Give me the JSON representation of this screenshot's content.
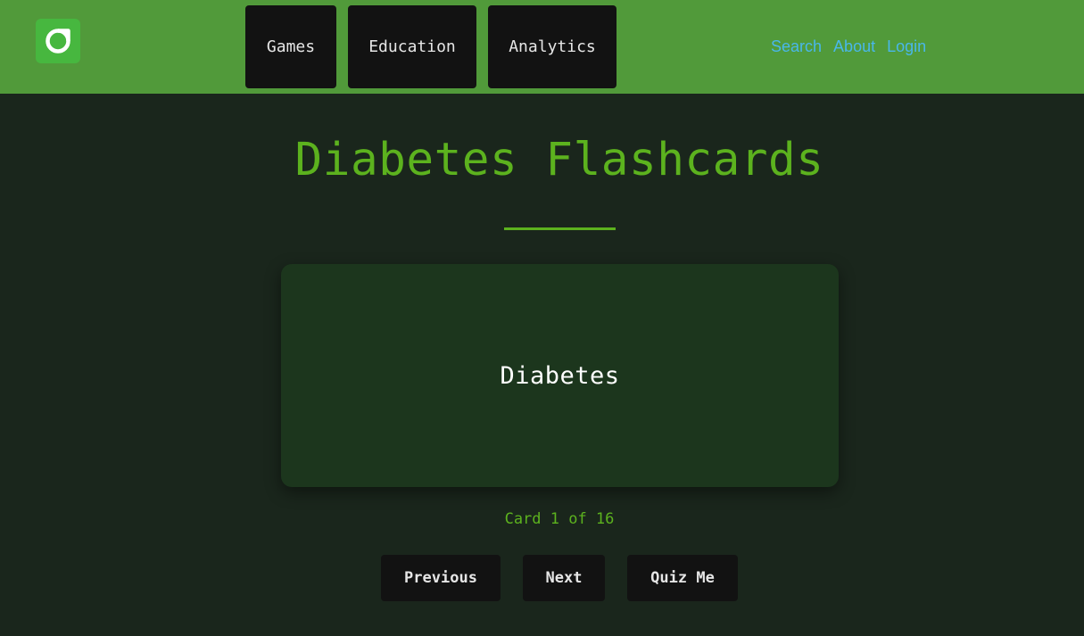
{
  "header": {
    "logo_icon": "app-logo-icon",
    "nav": [
      {
        "label": "Games"
      },
      {
        "label": "Education"
      },
      {
        "label": "Analytics"
      }
    ],
    "links": [
      {
        "label": "Search"
      },
      {
        "label": "About"
      },
      {
        "label": "Login"
      }
    ]
  },
  "main": {
    "title": "Diabetes Flashcards",
    "card": {
      "text": "Diabetes"
    },
    "counter": "Card 1 of 16",
    "controls": {
      "previous_label": "Previous",
      "next_label": "Next",
      "quiz_label": "Quiz Me"
    }
  },
  "colors": {
    "header_bg": "#519a3a",
    "page_bg": "#1a261c",
    "accent_green": "#5cb21e",
    "card_bg": "#1c361d",
    "button_bg": "#121212",
    "link_blue": "#49b7ea"
  }
}
